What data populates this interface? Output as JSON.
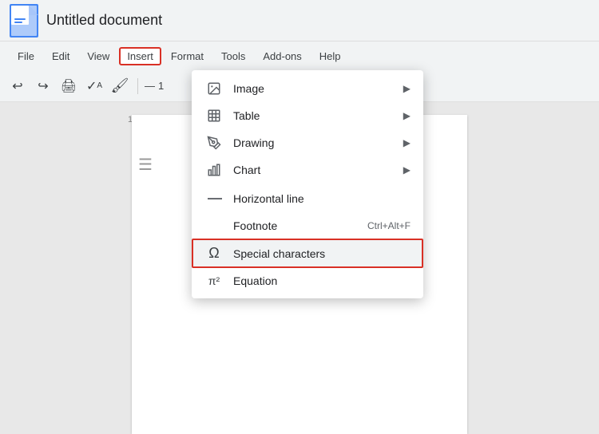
{
  "app": {
    "title": "Untitled document"
  },
  "menubar": {
    "items": [
      {
        "id": "file",
        "label": "File"
      },
      {
        "id": "edit",
        "label": "Edit"
      },
      {
        "id": "view",
        "label": "View"
      },
      {
        "id": "insert",
        "label": "Insert",
        "active": true
      },
      {
        "id": "format",
        "label": "Format"
      },
      {
        "id": "tools",
        "label": "Tools"
      },
      {
        "id": "addons",
        "label": "Add-ons"
      },
      {
        "id": "help",
        "label": "Help"
      }
    ]
  },
  "dropdown": {
    "items": [
      {
        "id": "image",
        "label": "Image",
        "icon": "image",
        "hasArrow": true
      },
      {
        "id": "table",
        "label": "Table",
        "icon": "",
        "hasArrow": true
      },
      {
        "id": "drawing",
        "label": "Drawing",
        "icon": "",
        "hasArrow": true
      },
      {
        "id": "chart",
        "label": "Chart",
        "icon": "chart",
        "hasArrow": true
      },
      {
        "id": "hline",
        "label": "Horizontal line",
        "icon": "dash",
        "hasArrow": false
      },
      {
        "id": "footnote",
        "label": "Footnote",
        "icon": "",
        "shortcut": "Ctrl+Alt+F",
        "hasArrow": false
      },
      {
        "id": "special-characters",
        "label": "Special characters",
        "icon": "omega",
        "hasArrow": false,
        "highlighted": true
      },
      {
        "id": "equation",
        "label": "Equation",
        "icon": "pi",
        "hasArrow": false
      }
    ]
  }
}
